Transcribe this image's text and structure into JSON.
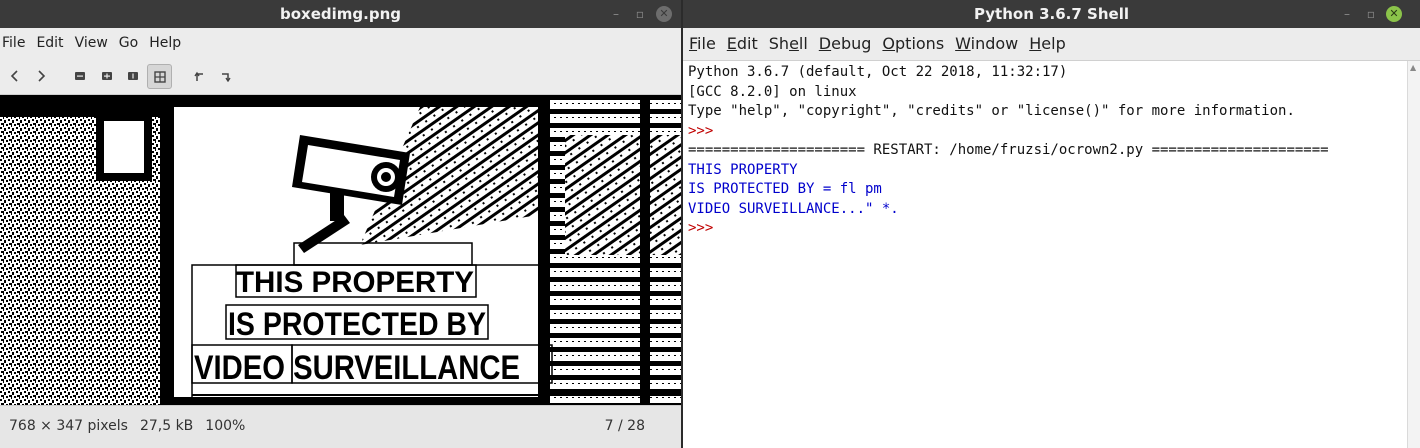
{
  "viewer": {
    "title": "boxedimg.png",
    "menu": [
      "File",
      "Edit",
      "View",
      "Go",
      "Help"
    ],
    "toolbar_icons": [
      "back-icon",
      "forward-icon",
      "zoom-out-icon",
      "zoom-in-icon",
      "normal-size-icon",
      "best-fit-icon",
      "rotate-left-icon",
      "rotate-right-icon"
    ],
    "image_text": {
      "line1": "THIS PROPERTY",
      "line2": "IS PROTECTED BY",
      "line3": "VIDEO SURVEILLANCE"
    },
    "status": {
      "dimensions": "768 × 347 pixels",
      "size": "27,5 kB",
      "zoom": "100%",
      "position": "7 / 28"
    }
  },
  "shell": {
    "title": "Python 3.6.7 Shell",
    "menu": [
      {
        "label": "File",
        "mnemonic": "F"
      },
      {
        "label": "Edit",
        "mnemonic": "E"
      },
      {
        "label": "Shell",
        "mnemonic": "e"
      },
      {
        "label": "Debug",
        "mnemonic": "D"
      },
      {
        "label": "Options",
        "mnemonic": "O"
      },
      {
        "label": "Window",
        "mnemonic": "W"
      },
      {
        "label": "Help",
        "mnemonic": "H"
      }
    ],
    "lines": [
      {
        "text": "Python 3.6.7 (default, Oct 22 2018, 11:32:17)",
        "color": "black"
      },
      {
        "text": "[GCC 8.2.0] on linux",
        "color": "black"
      },
      {
        "text": "Type \"help\", \"copyright\", \"credits\" or \"license()\" for more information.",
        "color": "black"
      },
      {
        "text": ">>> ",
        "color": "red"
      },
      {
        "text": "===================== RESTART: /home/fruzsi/ocrown2.py =====================",
        "color": "black"
      },
      {
        "text": "THIS PROPERTY",
        "color": "blue"
      },
      {
        "text": "IS PROTECTED BY = fl pm",
        "color": "blue"
      },
      {
        "text": "VIDEO SURVEILLANCE...\" *.",
        "color": "blue"
      },
      {
        "text": ">>> ",
        "color": "red"
      }
    ]
  },
  "colors": {
    "titlebar": "#3a3a3a",
    "close_green": "#8bc34a",
    "prompt_red": "#c00000",
    "output_blue": "#0000cc"
  }
}
